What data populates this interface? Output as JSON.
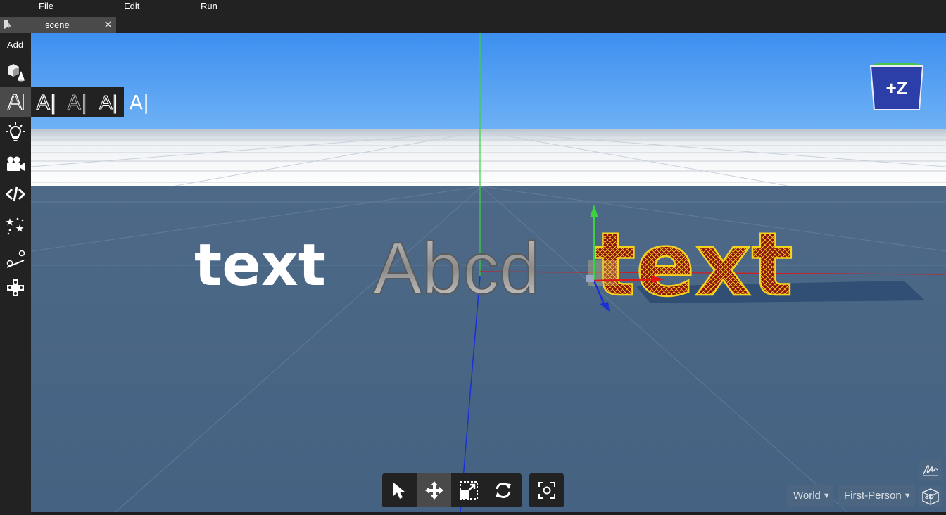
{
  "menu": {
    "file": "File",
    "edit": "Edit",
    "run": "Run"
  },
  "tab": {
    "label": "scene",
    "close": "✕"
  },
  "toolbar": {
    "add_label": "Add",
    "tools": [
      "cube-icon",
      "text-icon",
      "light-icon",
      "camera-icon",
      "code-icon",
      "particles-icon",
      "physics-icon",
      "controls-icon"
    ]
  },
  "text_submenu": {
    "items": [
      "A|",
      "A|",
      "A|",
      "A|"
    ]
  },
  "scene": {
    "flat_text": "text",
    "bump_text": "Abcd",
    "extruded_text": "text",
    "sky_color": "#4a9ff0",
    "ground_color": "#4e6a88"
  },
  "orientation_cube": {
    "label": "+Z"
  },
  "transform_tools": [
    "select-icon",
    "move-icon",
    "scale-icon",
    "rotate-icon"
  ],
  "focus_tool": "focus-icon",
  "space_select": {
    "value": "World"
  },
  "view_select": {
    "value": "First-Person"
  },
  "view3d_label": "3D"
}
